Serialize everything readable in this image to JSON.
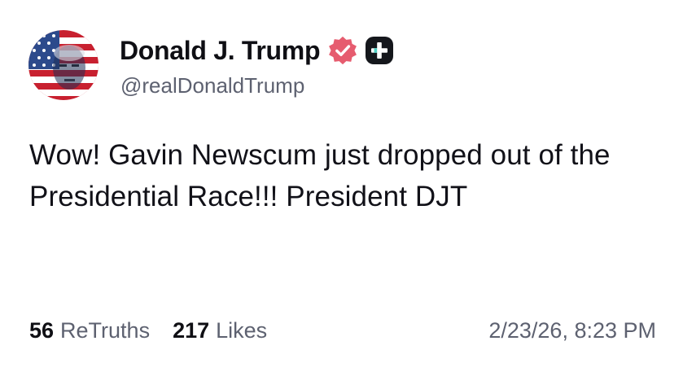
{
  "author": {
    "display_name": "Donald J. Trump",
    "handle": "@realDonaldTrump",
    "verified_icon": "verified-check-badge-icon",
    "plus_icon": "plus-badge-icon",
    "colors": {
      "verified": "#e65c6f",
      "plus_badge": "#15171c"
    }
  },
  "post": {
    "text": "Wow! Gavin Newscum just dropped out of the Presidential Race!!! President DJT"
  },
  "stats": {
    "retruths_count": "56",
    "retruths_label": "ReTruths",
    "likes_count": "217",
    "likes_label": "Likes"
  },
  "timestamp": "2/23/26, 8:23 PM"
}
